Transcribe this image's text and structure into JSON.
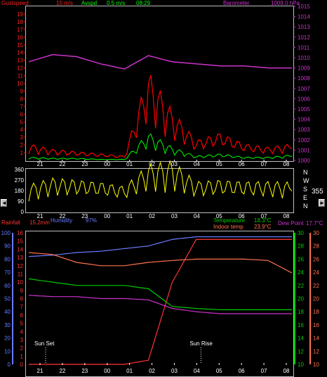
{
  "header": {
    "gust_label": "Gustspeed",
    "gust_value": "10 m/s",
    "avg_label": "Avspd",
    "avg_value": "0.5 m/s",
    "time": "08:29",
    "baro_label": "Barometer",
    "baro_value": "1009.0 hPa"
  },
  "wind_panel": {
    "direction_value": "355",
    "compass_labels": [
      "N",
      "W",
      "S",
      "E",
      "N"
    ],
    "dir_ticks": [
      "360",
      "270",
      "180",
      "90",
      "0"
    ]
  },
  "lower_header": {
    "rainfall_label": "Rainfall",
    "rainfall_value": "15.2mm",
    "humidity_label": "Humidity",
    "humidity_value": "97%",
    "temp_label": "Temperature",
    "temp_value": "18.3°C",
    "indoor_label": "Indoor temp",
    "indoor_value": "23.9°C",
    "dew_label": "Dew Point",
    "dew_value": "17.7°C"
  },
  "annotations": {
    "sunset": "Sun Set",
    "sunrise": "Sun Rise"
  },
  "hours": [
    "21",
    "22",
    "23",
    "00",
    "01",
    "02",
    "03",
    "04",
    "05",
    "06",
    "07",
    "08"
  ],
  "colors": {
    "wind": "#ff0000",
    "avg_wind": "#00ff00",
    "pressure": "#cc33cc",
    "direction": "#ffff00",
    "humidity": "#6a7bff",
    "temperature": "#00cc00",
    "indoor": "#ff7050",
    "dewpoint": "#cc33cc",
    "rain": "#ff3333"
  },
  "chart_data": [
    {
      "type": "line",
      "x": [
        "21",
        "22",
        "23",
        "00",
        "01",
        "02",
        "03",
        "04",
        "05",
        "06",
        "07",
        "08"
      ],
      "ylim": [
        0,
        20
      ],
      "y2lim": [
        1000,
        1015
      ],
      "series": [
        {
          "name": "Gustspeed",
          "axis": "left",
          "values": [
            1.5,
            1.0,
            0.8,
            0.6,
            0.4,
            8.0,
            4.5,
            1.8,
            2.5,
            1.5,
            1.2,
            1.5
          ]
        },
        {
          "name": "Avspd",
          "axis": "left",
          "values": [
            0.3,
            0.2,
            0.2,
            0.1,
            0.1,
            2.5,
            1.2,
            0.4,
            0.6,
            0.3,
            0.3,
            0.5
          ]
        },
        {
          "name": "Barometer",
          "axis": "right",
          "values": [
            1009.6,
            1010.3,
            1010.1,
            1009.4,
            1008.9,
            1010.2,
            1009.6,
            1009.4,
            1009.2,
            1009.2,
            1009.0,
            1009.0
          ]
        }
      ],
      "left_ticks": [
        "19",
        "18",
        "17",
        "16",
        "15",
        "14",
        "13",
        "12",
        "11",
        "10",
        "9",
        "8",
        "7",
        "6",
        "5",
        "4",
        "3",
        "2",
        "1"
      ],
      "right_ticks": [
        "1015",
        "1014",
        "1013",
        "1012",
        "1011",
        "1010",
        "1009",
        "1008",
        "1007",
        "1006",
        "1005",
        "1004",
        "1003",
        "1002",
        "1001",
        "1000"
      ]
    },
    {
      "type": "line",
      "x": [
        "21",
        "22",
        "23",
        "00",
        "01",
        "02",
        "03",
        "04",
        "05",
        "06",
        "07",
        "08"
      ],
      "ylim": [
        0,
        360
      ],
      "series": [
        {
          "name": "Wind direction",
          "values": [
            160,
            200,
            190,
            175,
            150,
            280,
            300,
            180,
            190,
            180,
            180,
            175
          ]
        }
      ]
    },
    {
      "type": "line",
      "x": [
        "21",
        "22",
        "23",
        "00",
        "01",
        "02",
        "03",
        "04",
        "05",
        "06",
        "07",
        "08"
      ],
      "series": [
        {
          "name": "Humidity",
          "axis": "0-100",
          "values": [
            82,
            83,
            85,
            86,
            88,
            90,
            95,
            97,
            97,
            97,
            97,
            97
          ]
        },
        {
          "name": "Rainfall",
          "axis": "0-16",
          "values": [
            0,
            0,
            0,
            0,
            0,
            0.5,
            10,
            15.2,
            15.2,
            15.2,
            15.2,
            15.2
          ]
        },
        {
          "name": "Temperature",
          "axis": "10-30",
          "values": [
            23,
            22.5,
            22,
            22,
            22,
            21.5,
            18.8,
            18.5,
            18.3,
            18.3,
            18.3,
            18.3
          ]
        },
        {
          "name": "Indoor temp",
          "axis": "10-30",
          "values": [
            27,
            26.7,
            25.5,
            25,
            25,
            25.5,
            25.8,
            26,
            26,
            26,
            25.8,
            23.9
          ]
        },
        {
          "name": "Dew Point",
          "axis": "10-30",
          "values": [
            20.5,
            20.3,
            20.3,
            20,
            20,
            19.8,
            18.5,
            18,
            17.7,
            17.7,
            17.7,
            17.7
          ]
        }
      ],
      "axis_0_100_ticks": [
        "100",
        "90",
        "80",
        "70",
        "60",
        "50",
        "40",
        "30",
        "20",
        "10",
        "0"
      ],
      "axis_0_16_ticks": [
        "16",
        "15",
        "14",
        "13",
        "12",
        "11",
        "10",
        "9",
        "8",
        "7",
        "6",
        "5",
        "4",
        "3",
        "2",
        "1",
        "0"
      ],
      "axis_10_30_ticks": [
        "30",
        "28",
        "26",
        "24",
        "22",
        "20",
        "18",
        "16",
        "14",
        "12",
        "10"
      ]
    }
  ]
}
